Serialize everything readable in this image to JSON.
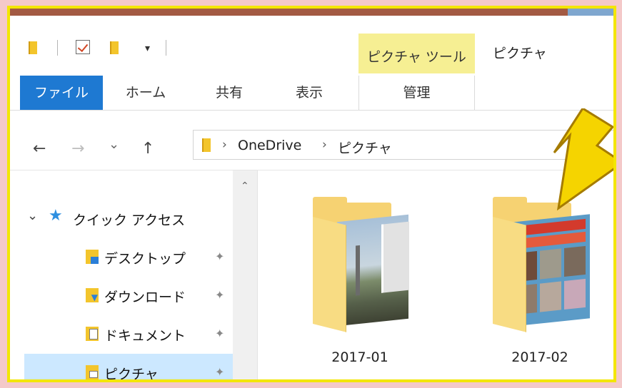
{
  "quick_access_toolbar": {
    "dropdown_symbol": "▾"
  },
  "ribbon": {
    "context_tab_group": "ピクチャ ツール",
    "window_title": "ピクチャ",
    "tabs": [
      {
        "label": "ファイル",
        "active": true
      },
      {
        "label": "ホーム"
      },
      {
        "label": "共有"
      },
      {
        "label": "表示"
      },
      {
        "label": "管理"
      }
    ]
  },
  "navigation": {
    "back": "←",
    "forward": "→",
    "recent": "⌄",
    "up": "↑",
    "path": [
      "OneDrive",
      "ピクチャ"
    ]
  },
  "sidebar": {
    "quick_access_label": "クイック アクセス",
    "items": [
      {
        "label": "デスクトップ",
        "icon": "desktop-folder-icon",
        "pinned": true
      },
      {
        "label": "ダウンロード",
        "icon": "downloads-folder-icon",
        "pinned": true
      },
      {
        "label": "ドキュメント",
        "icon": "documents-folder-icon",
        "pinned": true
      },
      {
        "label": "ピクチャ",
        "icon": "pictures-folder-icon",
        "pinned": true,
        "selected": true
      }
    ]
  },
  "content": {
    "folders": [
      {
        "name": "2017-01"
      },
      {
        "name": "2017-02"
      }
    ]
  },
  "colors": {
    "accent": "#1e79d2",
    "context_tab": "#f6ef93",
    "selection": "#cce8ff",
    "highlight_border": "#f3e600",
    "annotation_arrow": "#f5d400"
  }
}
